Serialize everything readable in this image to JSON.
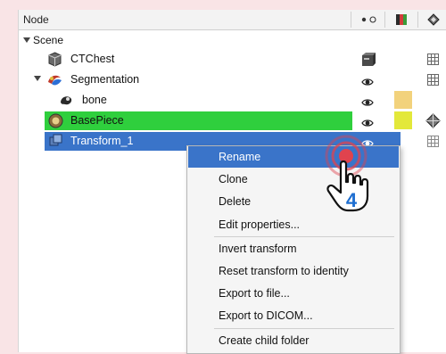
{
  "header": {
    "node_label": "Node"
  },
  "tree": [
    {
      "label": "Scene"
    },
    {
      "label": "CTChest"
    },
    {
      "label": "Segmentation"
    },
    {
      "label": "bone"
    },
    {
      "label": "BasePiece"
    },
    {
      "label": "Transform_1"
    }
  ],
  "colors": {
    "selected_row": "#3a74c9",
    "basepiece_row": "#2fcf3d",
    "bone_swatch": "#f2d27c",
    "basepiece_swatch": "#e3e83a",
    "click_marker": "#e0434e",
    "step_badge": "#1f6fd1"
  },
  "context_menu": {
    "items": [
      {
        "label": "Rename"
      },
      {
        "label": "Clone"
      },
      {
        "label": "Delete"
      },
      {
        "label": "Edit properties..."
      },
      {
        "label": "Invert transform"
      },
      {
        "label": "Reset transform to identity"
      },
      {
        "label": "Export to file..."
      },
      {
        "label": "Export to DICOM..."
      },
      {
        "label": "Create child folder"
      }
    ]
  },
  "annotation": {
    "step_number": "4",
    "cursor_icon": "hand-pointer-icon"
  }
}
